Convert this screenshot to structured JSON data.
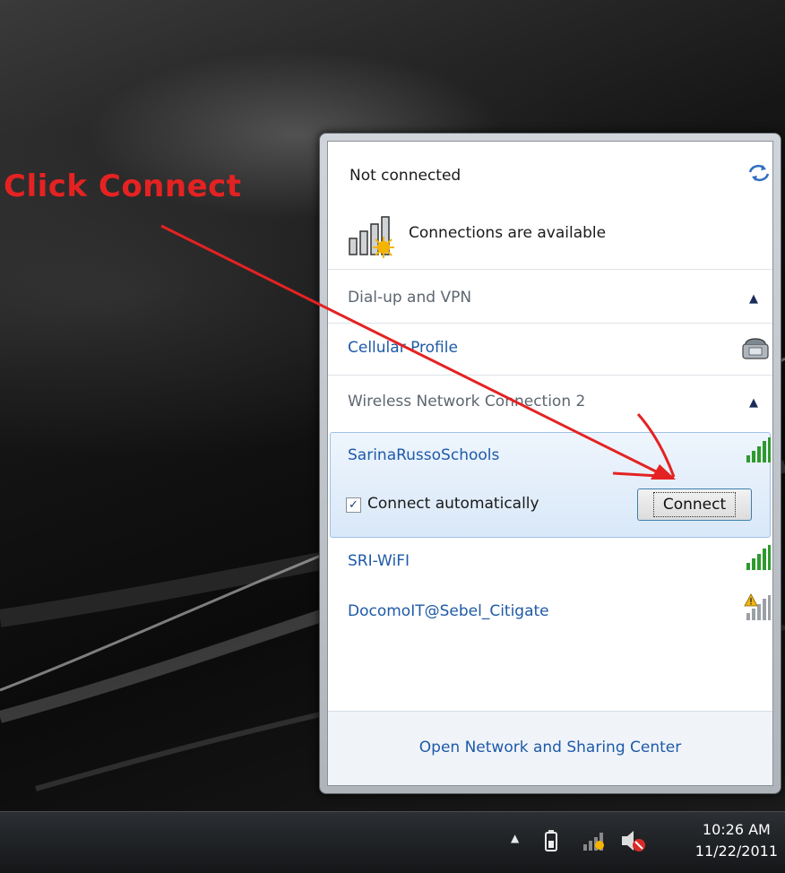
{
  "annotation": {
    "text": "Click Connect",
    "color": "#e52222"
  },
  "flyout": {
    "status": "Not connected",
    "availability": "Connections are available",
    "dialup_header": "Dial-up and VPN",
    "cellular_profile": "Cellular Profile",
    "wireless_header": "Wireless Network Connection 2",
    "networks": [
      {
        "name": "SarinaRussoSchools",
        "selected": true
      },
      {
        "name": "SRI-WiFI"
      },
      {
        "name": "DocomoIT@Sebel_Citigate"
      }
    ],
    "connect_automatically": "Connect automatically",
    "connect_automatically_checked": true,
    "connect_button": "Connect",
    "footer_link": "Open Network and Sharing Center"
  },
  "taskbar": {
    "time": "10:26 AM",
    "date": "11/22/2011",
    "tray_icons": [
      "show-hidden-icons-arrow",
      "battery-icon",
      "network-icon",
      "volume-muted-icon"
    ]
  },
  "colors": {
    "link": "#1e5aa8",
    "selection": "#d9e8f8",
    "annotation": "#e52222"
  }
}
